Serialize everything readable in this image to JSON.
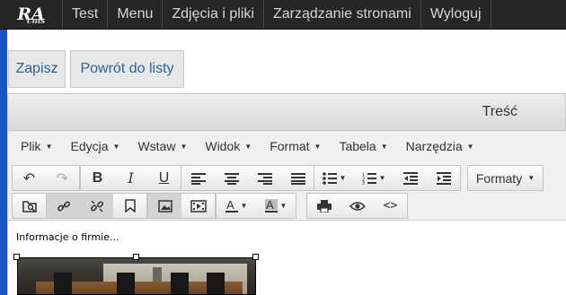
{
  "nav": {
    "logo_main": "RA",
    "logo_sub": "cms",
    "items": [
      "Test",
      "Menu",
      "Zdjęcia i pliki",
      "Zarządzanie stronami",
      "Wyloguj"
    ]
  },
  "actions": {
    "save": "Zapisz",
    "back": "Powrót do listy"
  },
  "content_header": "Treść",
  "editor": {
    "menu": [
      "Plik",
      "Edycja",
      "Wstaw",
      "Widok",
      "Format",
      "Tabela",
      "Narzędzia"
    ],
    "formats_label": "Formaty",
    "body_text": "Informacje o firmie..."
  },
  "colors": {
    "navbar": "#262626",
    "accent": "#1a56c4",
    "link": "#2a6496"
  }
}
